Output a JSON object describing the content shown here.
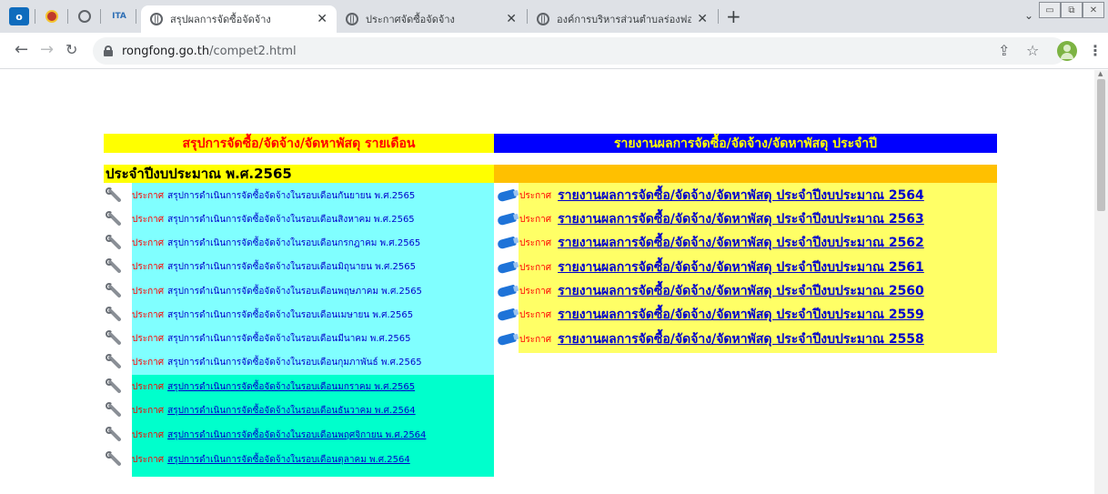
{
  "browser": {
    "tabs": [
      {
        "title": "สรุปผลการจัดซื้อจัดจ้าง",
        "active": true
      },
      {
        "title": "ประกาศจัดซื้อจัดจ้าง",
        "active": false
      },
      {
        "title": "องค์การบริหารส่วนตำบลร่องฟอง(ข่าวอ",
        "active": false
      }
    ],
    "pinned_ita_label": "ITA",
    "new_tab": "+",
    "url_host": "rongfong.go.th",
    "url_path": "/compet2.html"
  },
  "page": {
    "left_header": "สรุปการจัดซื้อ/จัดจ้าง/จัดหาพัสดุ รายเดือน",
    "right_header": "รายงานผลการจัดซื้อ/จัดจ้าง/จัดหาพัสดุ ประจำปี",
    "fiscal_year": "ประจำปีงบประมาณ พ.ศ.2565",
    "notice_tag": "ประกาศ",
    "monthly_items": [
      "สรุปการดำเนินการจัดซื้อจัดจ้างในรอบเดือนกันยายน พ.ศ.2565",
      "สรุปการดำเนินการจัดซื้อจัดจ้างในรอบเดือนสิงหาคม พ.ศ.2565",
      "สรุปการดำเนินการจัดซื้อจัดจ้างในรอบเดือนกรกฎาคม พ.ศ.2565",
      "สรุปการดำเนินการจัดซื้อจัดจ้างในรอบเดือนมิถุนายน พ.ศ.2565",
      "สรุปการดำเนินการจัดซื้อจัดจ้างในรอบเดือนพฤษภาคม พ.ศ.2565",
      "สรุปการดำเนินการจัดซื้อจัดจ้างในรอบเดือนเมษายน พ.ศ.2565",
      "สรุปการดำเนินการจัดซื้อจัดจ้างในรอบเดือนมีนาคม พ.ศ.2565",
      "สรุปการดำเนินการจัดซื้อจัดจ้างในรอบเดือนกุมภาพันธ์ พ.ศ.2565",
      "สรุปการดำเนินการจัดซื้อจัดจ้างในรอบเดือนมกราคม พ.ศ.2565",
      "สรุปการดำเนินการจัดซื้อจัดจ้างในรอบเดือนธันวาคม พ.ศ.2564",
      "สรุปการดำเนินการจัดซื้อจัดจ้างในรอบเดือนพฤศจิกายน พ.ศ.2564",
      "สรุปการดำเนินการจัดซื้อจัดจ้างในรอบเดือนตุลาคม พ.ศ.2564"
    ],
    "annual_items": [
      "รายงานผลการจัดซื้อ/จัดจ้าง/จัดหาพัสดุ ประจำปีงบประมาณ 2564",
      "รายงานผลการจัดซื้อ/จัดจ้าง/จัดหาพัสดุ ประจำปีงบประมาณ 2563",
      "รายงานผลการจัดซื้อ/จัดจ้าง/จัดหาพัสดุ ประจำปีงบประมาณ 2562",
      "รายงานผลการจัดซื้อ/จัดจ้าง/จัดหาพัสดุ ประจำปีงบประมาณ 2561",
      "รายงานผลการจัดซื้อ/จัดจ้าง/จัดหาพัสดุ ประจำปีงบประมาณ 2560",
      "รายงานผลการจัดซื้อ/จัดจ้าง/จัดหาพัสดุ ประจำปีงบประมาณ 2559",
      "รายงานผลการจัดซื้อ/จัดจ้าง/จัดหาพัสดุ ประจำปีงบประมาณ 2558"
    ]
  },
  "colors": {
    "left_header_bg": "#ffff00",
    "left_header_text": "#ff0000",
    "right_header_bg": "#0000ff",
    "right_header_text": "#ffff00",
    "cyan_panel": "#80ffff",
    "teal_panel": "#00ffcc",
    "annual_panel": "#ffff66",
    "orange_bar": "#ffc000"
  },
  "icons": {
    "left_item": "wrench-icon",
    "right_item": "pen-icon"
  }
}
